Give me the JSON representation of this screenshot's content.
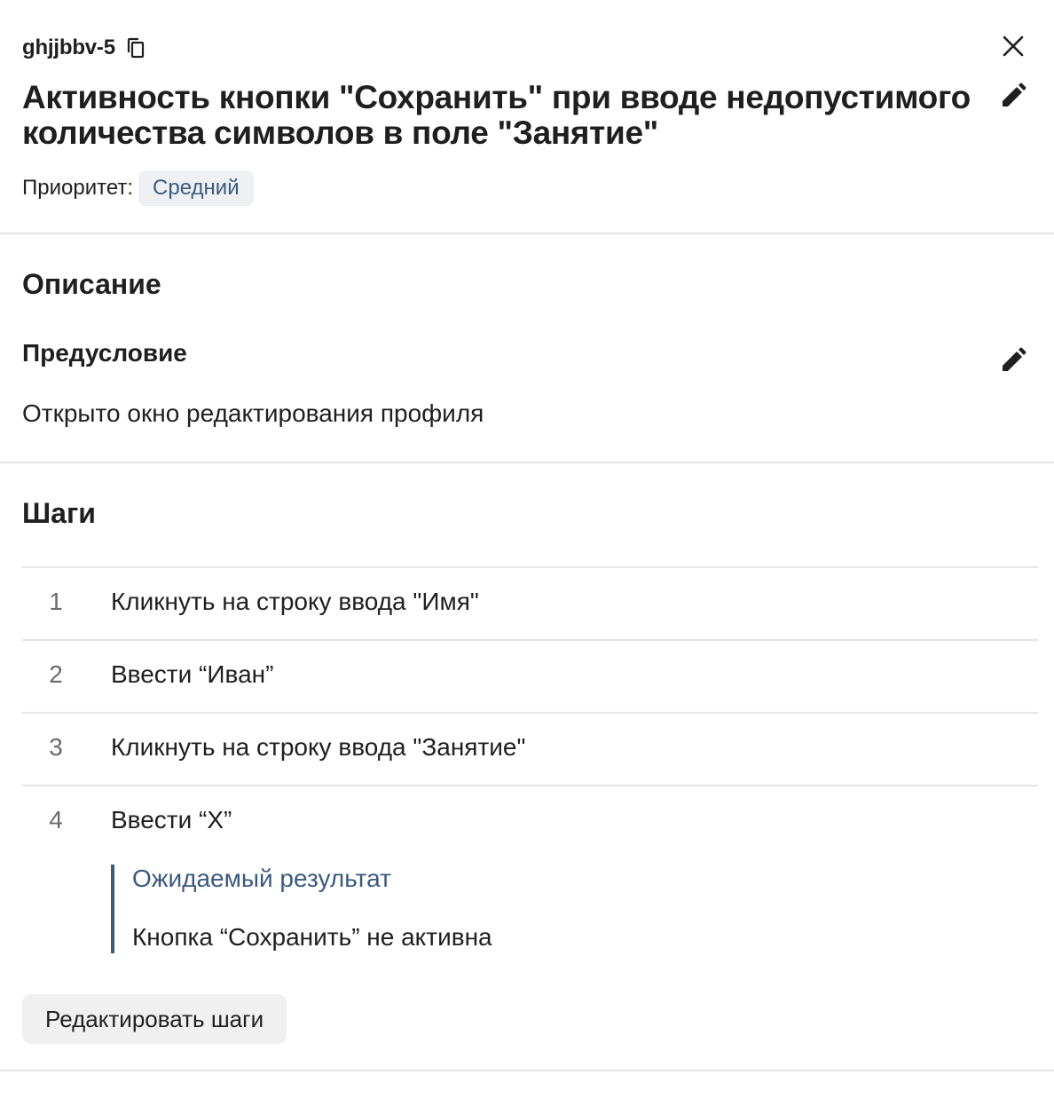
{
  "header": {
    "case_id": "ghjjbbv-5",
    "title": "Активность кнопки \"Сохранить\" при вводе недопустимого количества символов в поле \"Занятие\"",
    "priority_label": "Приоритет:",
    "priority_value": "Средний",
    "icons": {
      "copy": "copy-icon",
      "close": "close-icon",
      "edit": "pencil-icon"
    }
  },
  "description": {
    "section_title": "Описание",
    "precondition_title": "Предусловие",
    "precondition_text": "Открыто окно редактирования профиля"
  },
  "steps": {
    "section_title": "Шаги",
    "items": [
      {
        "number": "1",
        "text": "Кликнуть на строку ввода \"Имя\""
      },
      {
        "number": "2",
        "text": "Ввести “Иван”"
      },
      {
        "number": "3",
        "text": "Кликнуть на строку ввода \"Занятие\""
      },
      {
        "number": "4",
        "text": "Ввести “Х”",
        "expected_label": "Ожидаемый результат",
        "expected_text": "Кнопка “Сохранить” не активна"
      }
    ],
    "edit_button_label": "Редактировать шаги"
  },
  "colors": {
    "accent": "#3b5a80",
    "badge_bg": "#eef0f3",
    "divider": "#e5e5e5",
    "button_bg": "#f0f0f0"
  }
}
